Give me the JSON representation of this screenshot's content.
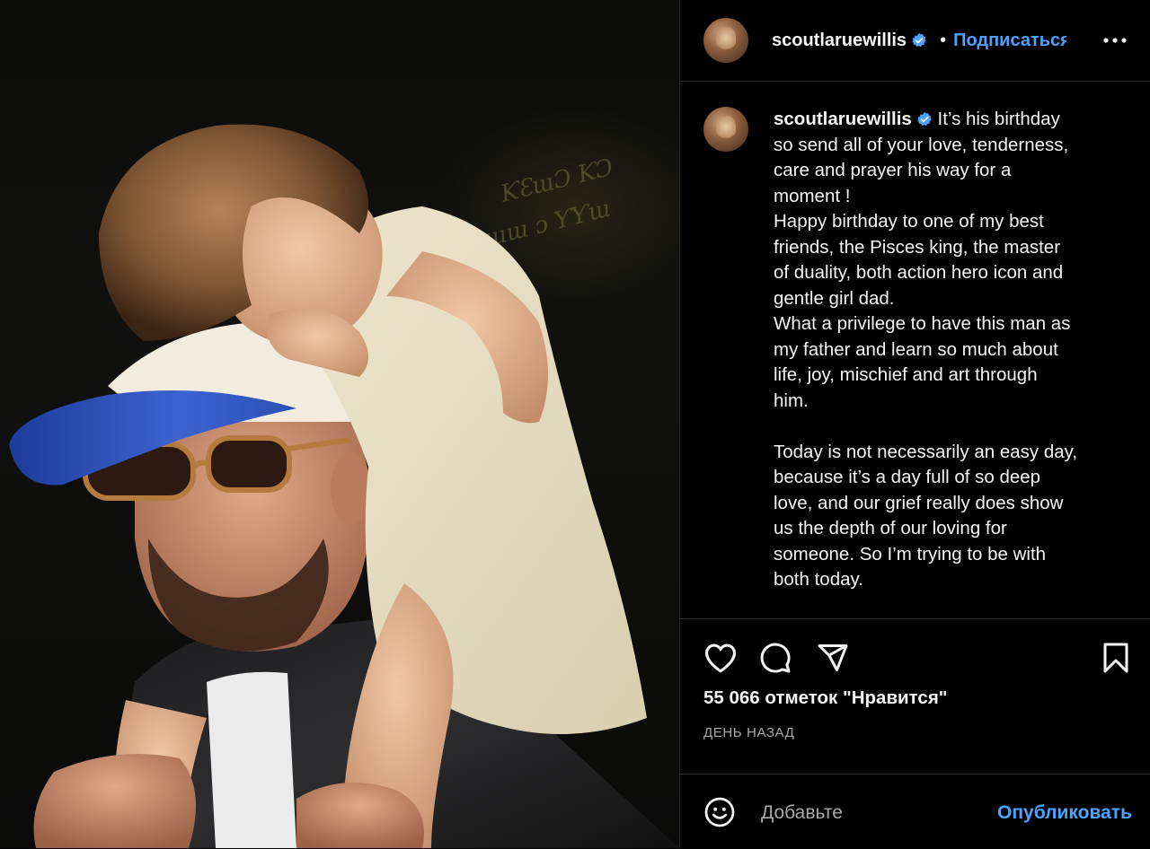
{
  "colors": {
    "accent": "#4ca3ff",
    "background": "#000000",
    "text": "#f5f5f5",
    "muted": "#a8a8a8",
    "divider": "#262626"
  },
  "media": {
    "description_icon": "photo"
  },
  "header": {
    "username": "scoutlaruewillis",
    "verified_icon": "verified-badge-icon",
    "separator": "•",
    "follow_label": "Подписаться",
    "more_icon": "more-options-icon"
  },
  "caption": {
    "username": "scoutlaruewillis",
    "text": " It’s his birthday\nso send all of your love, tenderness,\ncare and prayer his way for a\nmoment !\nHappy birthday to one of my best\nfriends, the Pisces king, the master\nof duality, both action hero icon and\ngentle girl dad.\nWhat a privilege to have this man as\nmy father and learn so much about\nlife, joy, mischief and art through\nhim.\n\nToday is not necessarily an easy day,\nbecause it’s a day full of so deep\nlove, and our grief really does show\nus the depth of our loving for\nsomeone. So I’m trying to be with\nboth today."
  },
  "actions": {
    "like_icon": "heart-icon",
    "comment_icon": "comment-icon",
    "share_icon": "send-icon",
    "save_icon": "bookmark-icon",
    "likes_text": "55 066 отметок \"Нравится\"",
    "time_text": "ДЕНЬ НАЗАД"
  },
  "comment": {
    "emoji_icon": "emoji-icon",
    "placeholder": "Добавьте",
    "publish_label": "Опубликовать"
  }
}
